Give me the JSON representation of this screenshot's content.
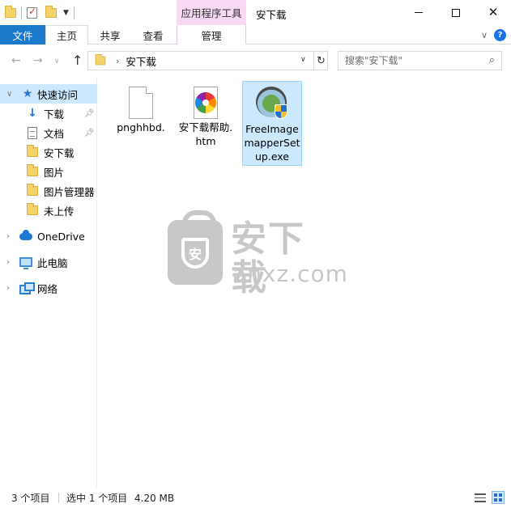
{
  "window": {
    "title": "安下载",
    "context_tab_group": "应用程序工具",
    "controls": {
      "minimize": "—",
      "maximize": "☐",
      "close": "✕"
    }
  },
  "ribbon": {
    "tabs": [
      {
        "label": "文件",
        "active": false
      },
      {
        "label": "主页",
        "active": true
      },
      {
        "label": "共享",
        "active": false
      },
      {
        "label": "查看",
        "active": false
      },
      {
        "label": "管理",
        "active": false
      }
    ],
    "expand_icon": "chevron-down-icon",
    "help_icon": "help-icon",
    "help_glyph": "?"
  },
  "address": {
    "path": [
      "安下载"
    ],
    "separator": "›",
    "search_placeholder": "搜索\"安下载\""
  },
  "nav": {
    "items": [
      {
        "label": "快速访问",
        "icon": "star-icon",
        "selected": true
      },
      {
        "label": "下载",
        "icon": "download-icon",
        "pinned": true
      },
      {
        "label": "文档",
        "icon": "document-icon",
        "pinned": true
      },
      {
        "label": "安下载",
        "icon": "folder-icon"
      },
      {
        "label": "图片",
        "icon": "folder-icon"
      },
      {
        "label": "图片管理器",
        "icon": "folder-icon"
      },
      {
        "label": "未上传",
        "icon": "folder-icon"
      },
      {
        "label": "OneDrive",
        "icon": "cloud-icon"
      },
      {
        "label": "此电脑",
        "icon": "computer-icon"
      },
      {
        "label": "网络",
        "icon": "network-icon"
      }
    ]
  },
  "files": [
    {
      "name": "pnghhbd.",
      "icon": "blank-file-icon",
      "selected": false
    },
    {
      "name": "安下载帮助.htm",
      "icon": "htm-file-icon",
      "selected": false
    },
    {
      "name": "FreeImagemapperSetup.exe",
      "icon": "installer-exe-icon",
      "selected": true
    }
  ],
  "watermark": {
    "text_cn": "安下载",
    "text_en": "anxz.com",
    "badge": "安"
  },
  "status": {
    "item_count": "3 个项目",
    "selection": "选中 1 个项目",
    "size": "4.20 MB"
  },
  "colors": {
    "accent": "#1979ca",
    "selection": "#cce8ff",
    "context_tab": "#f7d9f4"
  }
}
